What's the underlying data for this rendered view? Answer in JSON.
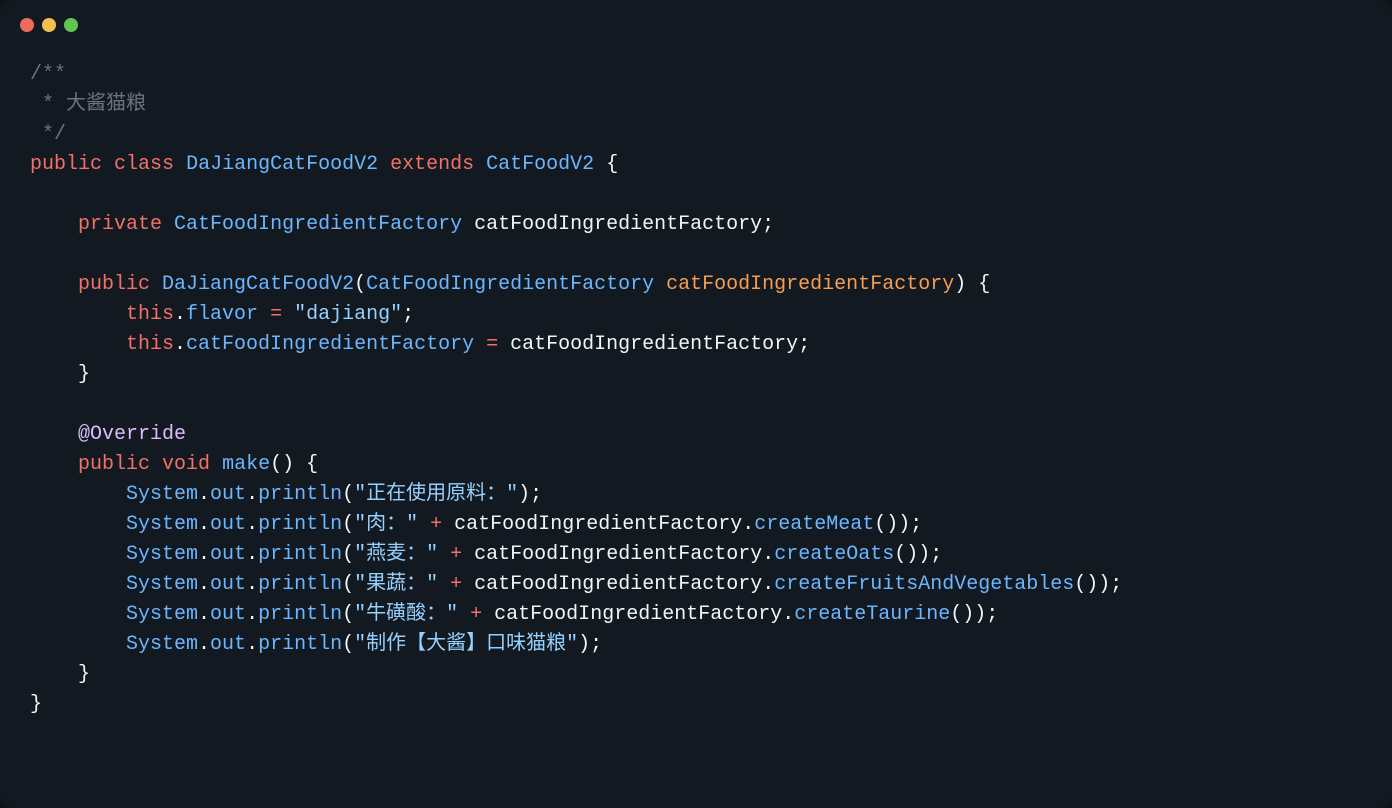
{
  "comment": {
    "line1": "/**",
    "line2": " * 大酱猫粮",
    "line3": " */"
  },
  "keywords": {
    "public": "public",
    "class": "class",
    "extends": "extends",
    "private": "private",
    "this": "this",
    "void": "void"
  },
  "classes": {
    "main": "DaJiangCatFoodV2",
    "parent": "CatFoodV2",
    "factory": "CatFoodIngredientFactory"
  },
  "fields": {
    "factoryField": "catFoodIngredientFactory",
    "flavor": "flavor"
  },
  "params": {
    "factoryParam": "catFoodIngredientFactory"
  },
  "strings": {
    "dajiang": "\"dajiang\"",
    "using": "\"正在使用原料：\"",
    "meat": "\"肉：\"",
    "oats": "\"燕麦：\"",
    "fruits": "\"果蔬：\"",
    "taurine": "\"牛磺酸：\"",
    "making": "\"制作【大酱】口味猫粮\""
  },
  "annotation": "@Override",
  "methods": {
    "make": "make",
    "println": "println",
    "createMeat": "createMeat",
    "createOats": "createOats",
    "createFruits": "createFruitsAndVegetables",
    "createTaurine": "createTaurine"
  },
  "identifiers": {
    "system": "System",
    "out": "out"
  }
}
